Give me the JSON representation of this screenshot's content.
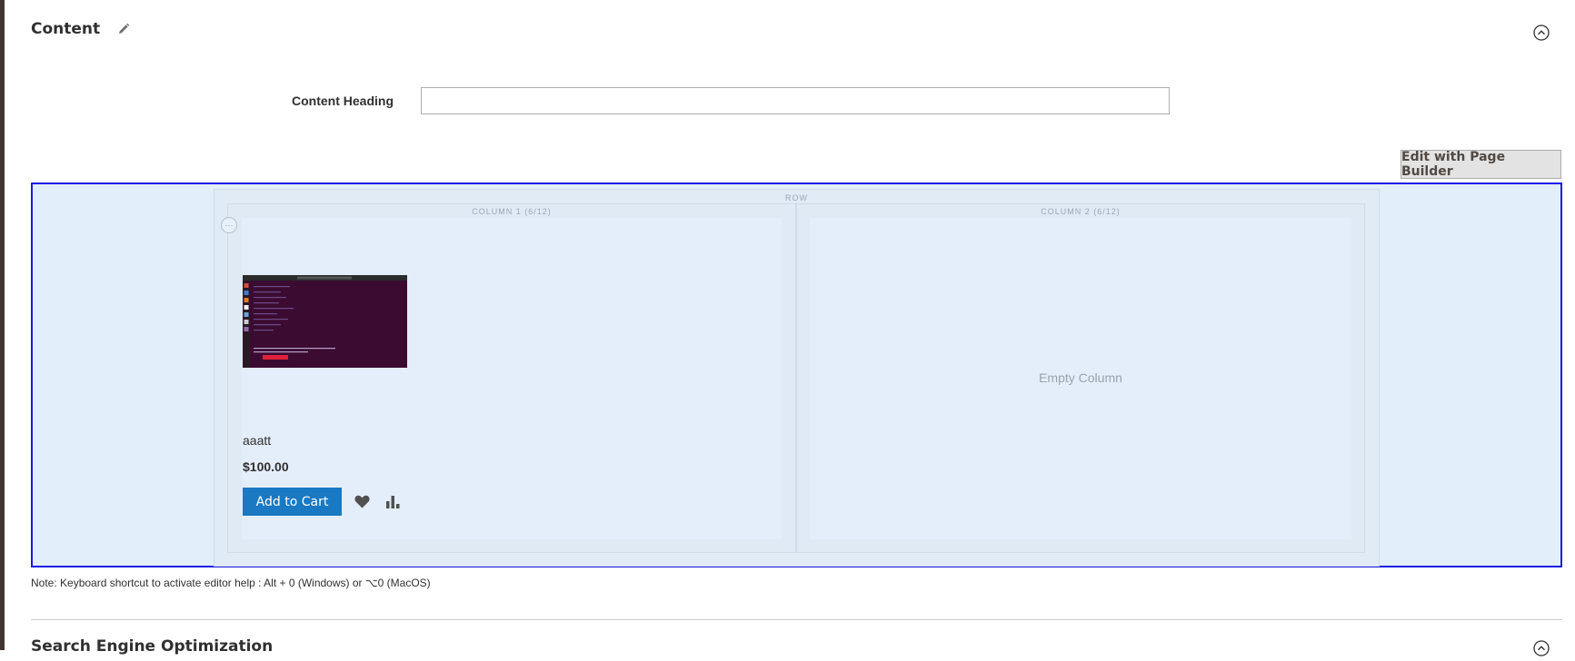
{
  "content_section": {
    "title": "Content",
    "edit_icon": "pencil-icon",
    "collapse_icon": "chevron-up-circle-icon"
  },
  "content_heading": {
    "label": "Content Heading",
    "value": "",
    "placeholder": ""
  },
  "page_builder_button": "Edit with Page Builder",
  "stage": {
    "row_label": "ROW",
    "columns": [
      {
        "label": "COLUMN 1 (6/12)"
      },
      {
        "label": "COLUMN 2 (6/12)",
        "empty_text": "Empty Column"
      }
    ],
    "move_handle_icon": "move-handle-icon",
    "accent_border": "#1d1ae6",
    "background": "#e2eefa"
  },
  "product": {
    "name": "aaatt",
    "price": "$100.00",
    "add_to_cart": "Add to Cart",
    "wishlist_icon": "heart-icon",
    "compare_icon": "bar-chart-icon",
    "button_color": "#1979c3"
  },
  "note": "Note: Keyboard shortcut to activate editor help : Alt + 0 (Windows) or ⌥0 (MacOS)",
  "seo_section": {
    "title": "Search Engine Optimization",
    "collapse_icon": "chevron-up-circle-icon"
  }
}
